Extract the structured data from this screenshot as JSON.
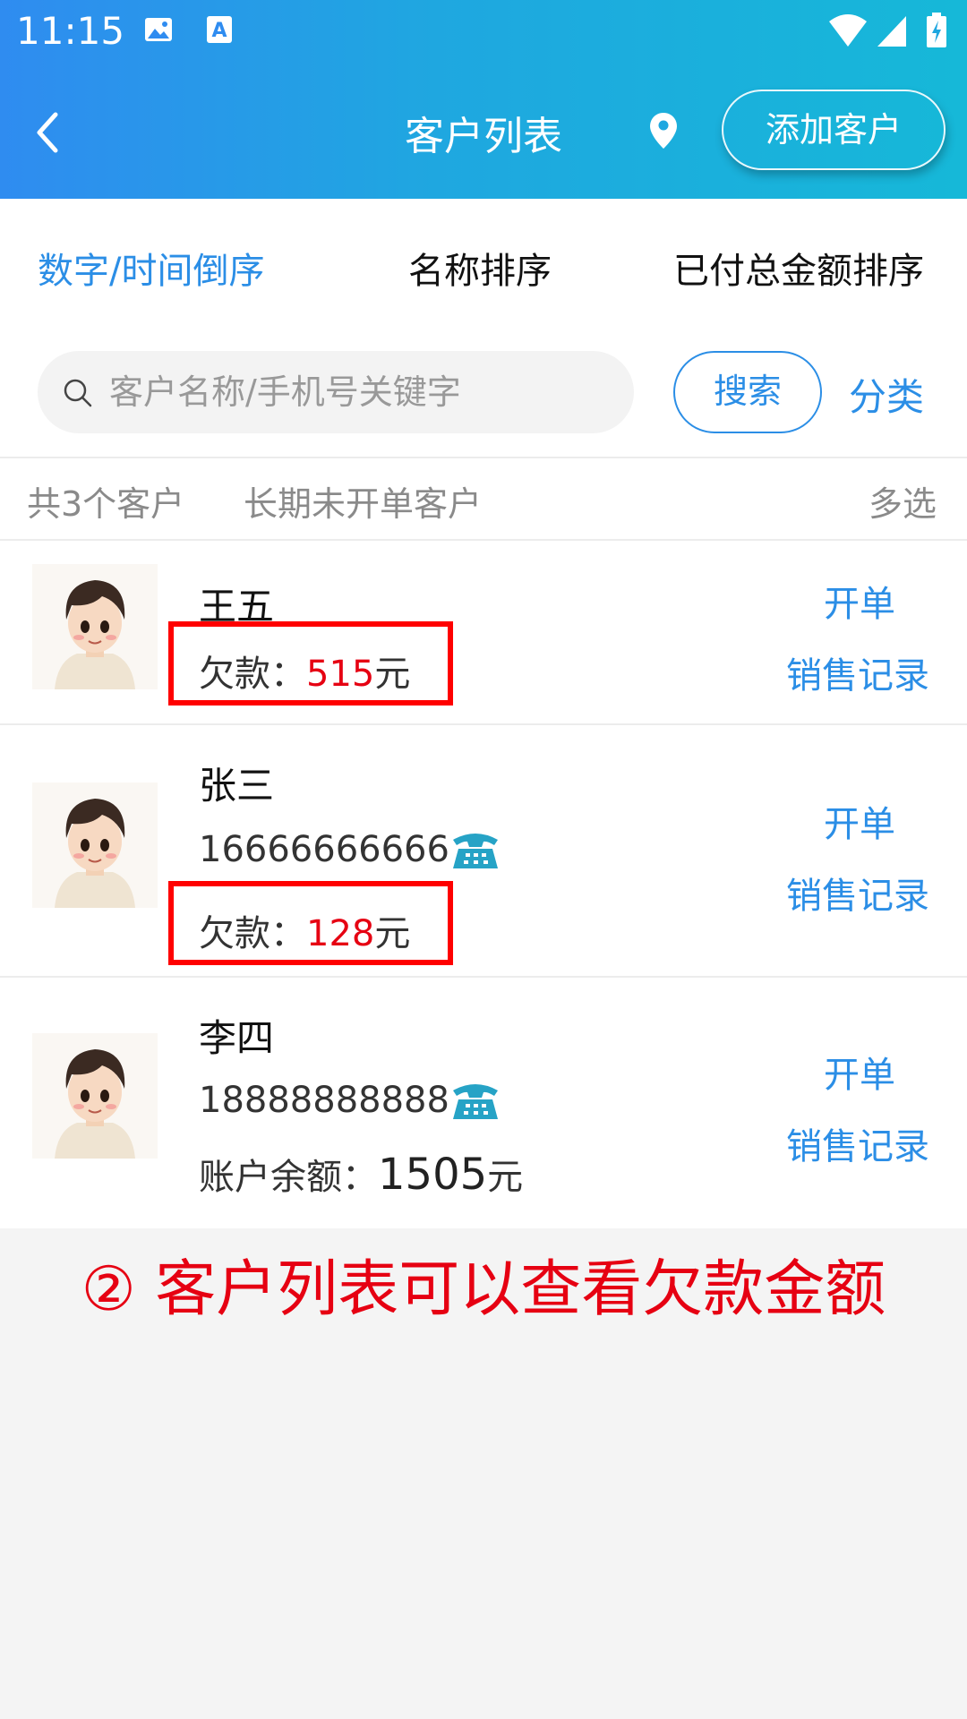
{
  "status_bar": {
    "time": "11:15",
    "icons": [
      "image-icon",
      "font-icon",
      "wifi-icon",
      "signal-icon",
      "battery-charging-icon"
    ]
  },
  "header": {
    "title": "客户列表",
    "add_button": "添加客户",
    "icons": [
      "back-arrow-icon",
      "location-pin-icon"
    ]
  },
  "sort_tabs": [
    {
      "label": "数字/时间倒序",
      "active": true
    },
    {
      "label": "名称排序",
      "active": false
    },
    {
      "label": "已付总金额排序",
      "active": false
    }
  ],
  "search": {
    "placeholder": "客户名称/手机号关键字",
    "button": "搜索",
    "category": "分类"
  },
  "info_bar": {
    "count": "共3个客户",
    "inactive_filter": "长期未开单客户",
    "multi_select": "多选"
  },
  "customers": [
    {
      "name": "王五",
      "debt_label": "欠款：",
      "debt_amount": "515",
      "unit": "元",
      "open_order": "开单",
      "sales_record": "销售记录"
    },
    {
      "name": "张三",
      "phone": "16666666666",
      "debt_label": "欠款：",
      "debt_amount": "128",
      "unit": "元",
      "open_order": "开单",
      "sales_record": "销售记录"
    },
    {
      "name": "李四",
      "phone": "18888888888",
      "balance_label": "账户余额：",
      "balance_amount": "1505",
      "unit": "元",
      "open_order": "开单",
      "sales_record": "销售记录"
    }
  ],
  "caption": "② 客户列表可以查看欠款金额",
  "colors": {
    "accent_blue": "#2b8ee6",
    "header_gradient_start": "#2f8cf0",
    "header_gradient_end": "#16b8d8",
    "debt_red": "#e60012",
    "highlight_box": "#ff0000",
    "phone_icon": "#26a3c6"
  }
}
